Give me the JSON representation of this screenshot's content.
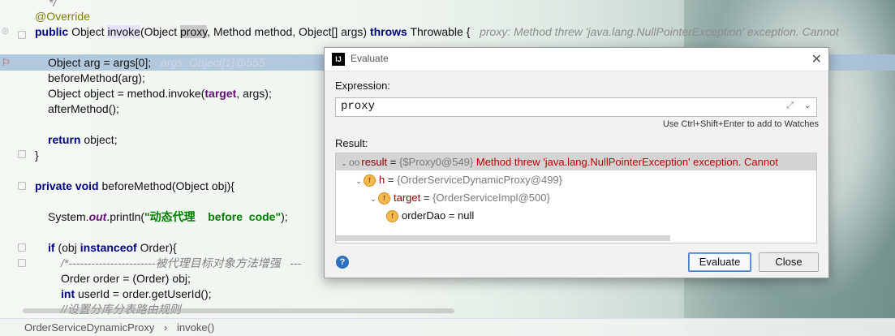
{
  "editor": {
    "lines": [
      {
        "parts": [
          {
            "t": "*/",
            "c": "cmt"
          }
        ]
      },
      {
        "parts": [
          {
            "t": "@Override",
            "c": "ann"
          }
        ]
      },
      {
        "parts": [
          {
            "t": "public",
            "c": "kw"
          },
          {
            "t": " Object "
          },
          {
            "t": "invoke",
            "c": "invoke-hl"
          },
          {
            "t": "(Object "
          },
          {
            "t": "proxy",
            "c": "sel"
          },
          {
            "t": ", Method method, Object[] args) "
          },
          {
            "t": "throws",
            "c": "kw"
          },
          {
            "t": " Throwable {   "
          },
          {
            "t": "proxy: Method threw 'java.lang.NullPointerException' exception. Cannot",
            "c": "hint"
          }
        ]
      },
      {
        "parts": []
      },
      {
        "parts": [
          {
            "t": "Object arg = args[0];   "
          },
          {
            "t": "args: Object[1]@555",
            "c": "hintw"
          }
        ]
      },
      {
        "parts": [
          {
            "t": "beforeMethod(arg);"
          }
        ]
      },
      {
        "parts": [
          {
            "t": "Object object = method.invoke("
          },
          {
            "t": "target",
            "c": "fld"
          },
          {
            "t": ", args);"
          }
        ]
      },
      {
        "parts": [
          {
            "t": "afterMethod();"
          }
        ]
      },
      {
        "parts": []
      },
      {
        "parts": [
          {
            "t": "return",
            "c": "kw"
          },
          {
            "t": " object;"
          }
        ]
      },
      {
        "parts": [
          {
            "t": "}"
          }
        ]
      },
      {
        "parts": []
      },
      {
        "parts": [
          {
            "t": "private void",
            "c": "kw"
          },
          {
            "t": " beforeMethod(Object obj){"
          }
        ]
      },
      {
        "parts": []
      },
      {
        "parts": [
          {
            "t": "System."
          },
          {
            "t": "out",
            "c": "fldi"
          },
          {
            "t": ".println("
          },
          {
            "t": "\"动态代理    before  code\"",
            "c": "str"
          },
          {
            "t": ");"
          }
        ]
      },
      {
        "parts": []
      },
      {
        "parts": [
          {
            "t": "if",
            "c": "kw"
          },
          {
            "t": " (obj "
          },
          {
            "t": "instanceof",
            "c": "kw"
          },
          {
            "t": " Order){"
          }
        ]
      },
      {
        "parts": [
          {
            "t": "/*-----------------------被代理目标对象方法增强   ---",
            "c": "cmt"
          }
        ]
      },
      {
        "parts": [
          {
            "t": "Order order = (Order) obj;"
          }
        ]
      },
      {
        "parts": [
          {
            "t": "int",
            "c": "kw"
          },
          {
            "t": " userId = order.getUserId();"
          }
        ]
      },
      {
        "parts": [
          {
            "t": "//设置分库分表路由规则",
            "c": "cmt"
          }
        ]
      }
    ]
  },
  "statusbar": {
    "class_name": "OrderServiceDynamicProxy",
    "separator": "›",
    "method_name": "invoke()"
  },
  "dialog": {
    "title": "Evaluate",
    "logo": "IJ",
    "close_icon": "✕",
    "expression_label": "Expression:",
    "expression_value": "proxy",
    "expand_icon": "⤢",
    "dropdown_icon": "⌄",
    "watch_hint": "Use Ctrl+Shift+Enter to add to Watches",
    "result_label": "Result:",
    "tree": [
      {
        "chev": "⌄",
        "icon": "oo",
        "name": "result",
        "sep": " = ",
        "ref": "{$Proxy0@549}",
        "extra": " Method threw 'java.lang.NullPointerException' exception. Cannot",
        "selected": true
      },
      {
        "chev": "⌄",
        "icon": "f",
        "name": "h",
        "sep": " = ",
        "ref": "{OrderServiceDynamicProxy@499}",
        "extra": ""
      },
      {
        "chev": "⌄",
        "icon": "f",
        "name": "target",
        "sep": " = ",
        "ref": "{OrderServiceImpl@500}",
        "extra": ""
      },
      {
        "chev": "",
        "icon": "f",
        "name": "orderDao",
        "sep": " = ",
        "ref": "null",
        "extra": ""
      }
    ],
    "help_icon": "?",
    "evaluate_button": "Evaluate",
    "close_button": "Close"
  }
}
